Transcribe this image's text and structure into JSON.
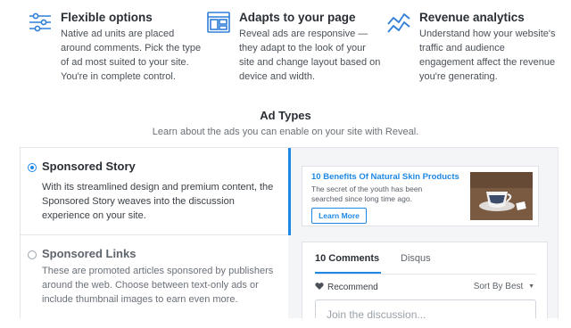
{
  "features": [
    {
      "icon": "sliders-icon",
      "title": "Flexible options",
      "description": "Native ad units are placed around comments. Pick the type of ad most suited to your site. You're in complete control."
    },
    {
      "icon": "responsive-layout-icon",
      "title": "Adapts to your page",
      "description": "Reveal ads are responsive — they adapt to the look of your site and change layout based on device and width."
    },
    {
      "icon": "analytics-trend-icon",
      "title": "Revenue analytics",
      "description": "Understand how your website's traffic and audience engagement affect the revenue you're generating."
    }
  ],
  "ad_types": {
    "title": "Ad Types",
    "subtitle": "Learn about the ads you can enable on your site with Reveal.",
    "options": [
      {
        "title": "Sponsored Story",
        "description": "With its streamlined design and premium content, the Sponsored Story weaves into the discussion experience on your site.",
        "selected": true
      },
      {
        "title": "Sponsored Links",
        "description": "These are promoted articles sponsored by publishers around the web. Choose between text-only ads or include thumbnail images to earn even more.",
        "selected": false
      }
    ]
  },
  "preview": {
    "ad": {
      "title": "10 Benefits Of Natural Skin Products",
      "description": "The secret of the youth has been searched since long time ago.",
      "button": "Learn More"
    },
    "disqus": {
      "tab_comments": "10 Comments",
      "tab_disqus": "Disqus",
      "recommend": "Recommend",
      "sort": "Sort By Best",
      "input_placeholder": "Join the discussion..."
    }
  },
  "colors": {
    "accent": "#1e88e5",
    "text": "#3a3f45",
    "border": "#e3e6ea"
  }
}
